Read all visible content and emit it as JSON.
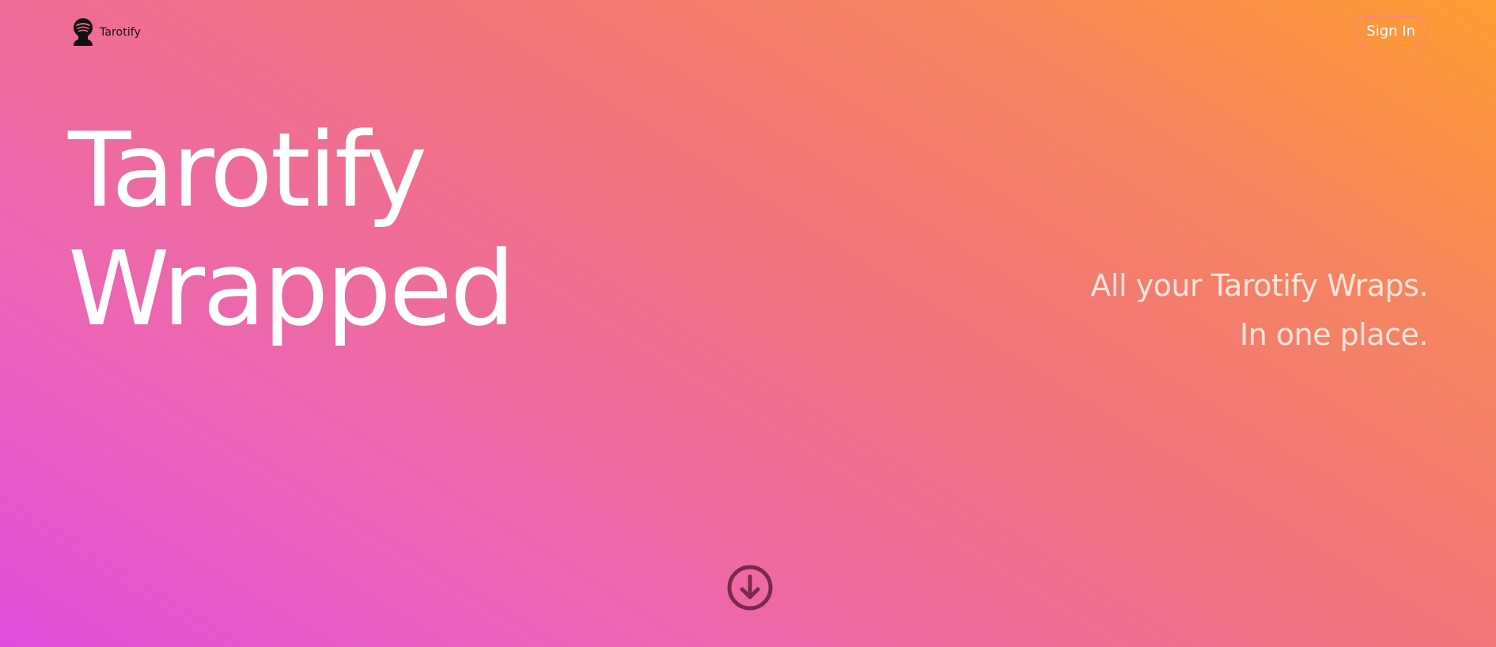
{
  "header": {
    "brand_name": "Tarotify",
    "logo_icon": "tarotify-logo-icon",
    "signin_label": "Sign In"
  },
  "hero": {
    "title_line1": "Tarotify",
    "title_line2": "Wrapped"
  },
  "tagline": {
    "line1": "All your Tarotify Wraps.",
    "line2": "In one place."
  },
  "scroll_down": {
    "icon": "arrow-down-circle-icon"
  },
  "colors": {
    "gradient_start": "#e04fdc",
    "gradient_mid": "#f1727f",
    "gradient_end": "#ff9d32",
    "text": "#ffffff",
    "scroll_icon": "#7a2a4a"
  }
}
